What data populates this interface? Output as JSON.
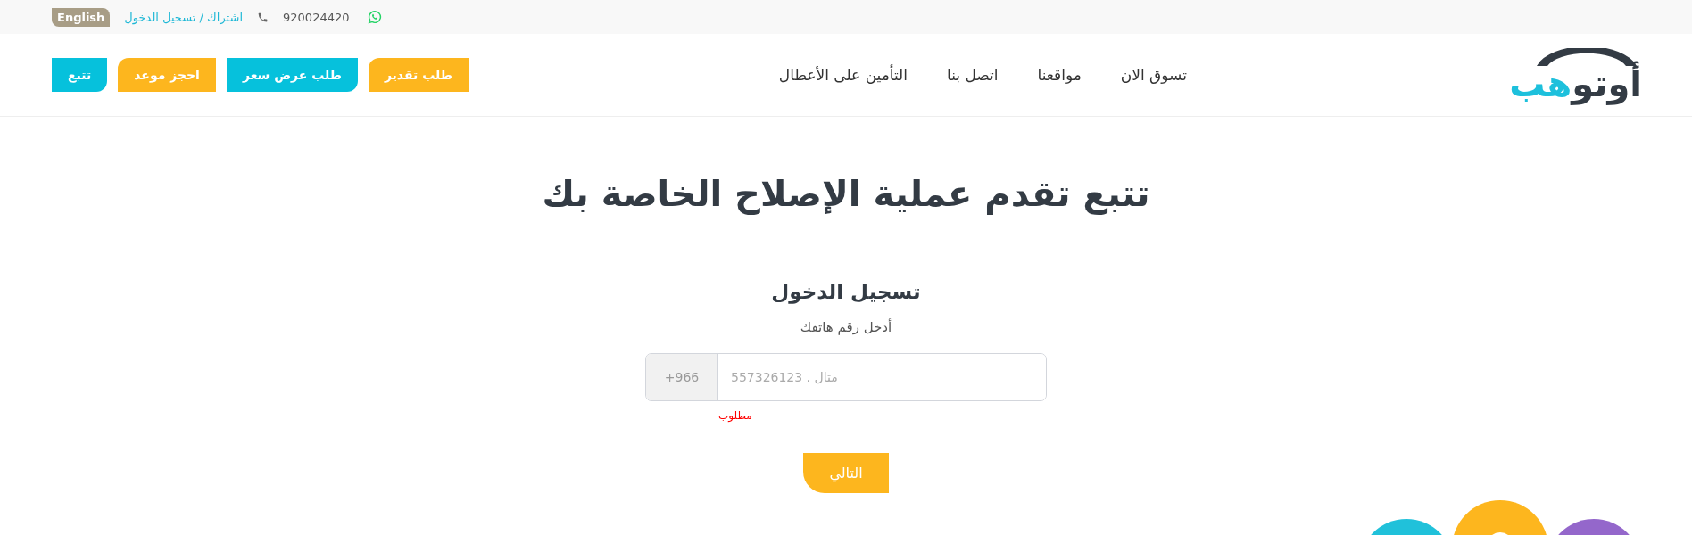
{
  "top_bar": {
    "phone": "920024420",
    "account_link": "اشتراك / تسجيل الدخول",
    "language_button": "English"
  },
  "logo": {
    "dark_text": "أوتو",
    "accent_text": "هب"
  },
  "nav": [
    "تسوق الان",
    "مواقعنا",
    "اتصل بنا",
    "التأمين على الأعطال"
  ],
  "action_buttons": [
    {
      "label": "طلب تقدير",
      "color": "#fdb61e"
    },
    {
      "label": "طلب عرض سعر",
      "color": "#06c1dc"
    },
    {
      "label": "احجز موعد",
      "color": "#fdb61e"
    },
    {
      "label": "تتبع",
      "color": "#06c1dc"
    }
  ],
  "page_title": "تتبع تقدم عملية الإصلاح الخاصة بك",
  "login": {
    "title": "تسجيل الدخول",
    "subtitle": "أدخل رقم هاتفك",
    "prefix": "+966",
    "placeholder": "557326123 . مثال",
    "error": "مطلوب",
    "next_button": "التالي"
  }
}
